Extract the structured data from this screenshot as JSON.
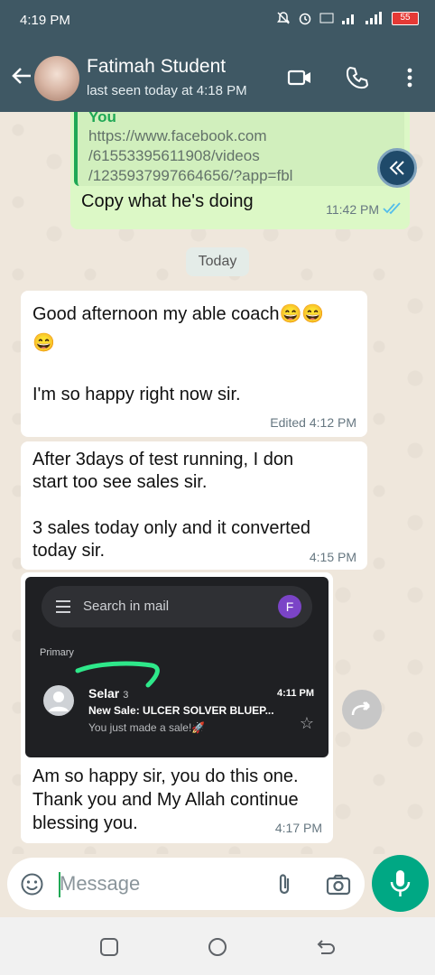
{
  "status_bar": {
    "time": "4:19 PM",
    "battery": "55"
  },
  "header": {
    "contact_name": "Fatimah Student",
    "last_seen": "last seen today at 4:18 PM"
  },
  "messages": {
    "outgoing_quote_author": "You",
    "outgoing_quote_link_line1": "https://www.facebook.com",
    "outgoing_quote_link_line2": "/61553395611908/videos",
    "outgoing_quote_link_line3": "/1235937997664656/?app=fbl",
    "outgoing_text": "Copy what he's doing",
    "outgoing_time": "11:42 PM",
    "date_divider": "Today",
    "msg1_line1": "Good afternoon my able coach😄😄",
    "msg1_line2": "😄",
    "msg1_line3": "I'm so happy right now sir.",
    "msg1_meta": "Edited 4:12 PM",
    "msg2_line1": "After 3days of test running, I don",
    "msg2_line2": "start too see sales sir.",
    "msg2_line3": "3 sales today only and it converted",
    "msg2_line4": "today sir.",
    "msg2_time": "4:15 PM",
    "img_caption_line1": "Am so happy sir, you do this one.",
    "img_caption_line2": "Thank you and My Allah continue",
    "img_caption_line3": "blessing you.",
    "img_time": "4:17 PM"
  },
  "mail_screenshot": {
    "search_label": "Search in mail",
    "avatar_letter": "F",
    "section": "Primary",
    "sender": "Selar",
    "count": "3",
    "time": "4:11 PM",
    "subject": "New Sale: ULCER SOLVER BLUEP...",
    "snippet": "You just made a sale!🚀"
  },
  "composer": {
    "placeholder": "Message"
  },
  "colors": {
    "header": "#3f5864",
    "outgoing_bubble": "#dcf8c6",
    "accent_green": "#00a884"
  },
  "icons": [
    "back-arrow-icon",
    "video-call-icon",
    "phone-icon",
    "more-vert-icon",
    "forward-icon",
    "emoji-icon",
    "attach-icon",
    "camera-icon",
    "mic-icon",
    "recent-apps-icon",
    "home-icon",
    "back-nav-icon"
  ]
}
